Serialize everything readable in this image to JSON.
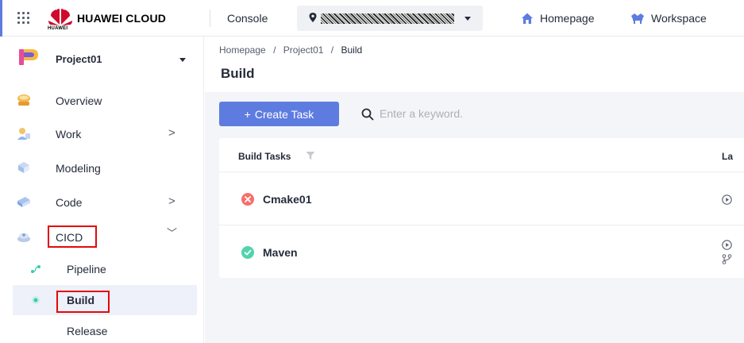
{
  "topbar": {
    "brand": "HUAWEI CLOUD",
    "logo_text": "HUAWEI",
    "console": "Console",
    "homepage": "Homepage",
    "workspace": "Workspace"
  },
  "sidebar": {
    "project": "Project01",
    "items": [
      {
        "label": "Overview"
      },
      {
        "label": "Work",
        "chevron": ">"
      },
      {
        "label": "Modeling"
      },
      {
        "label": "Code",
        "chevron": ">"
      },
      {
        "label": "CICD",
        "chevron": "﹀"
      }
    ],
    "subitems": [
      {
        "label": "Pipeline"
      },
      {
        "label": "Build"
      },
      {
        "label": "Release"
      }
    ]
  },
  "main": {
    "breadcrumb": {
      "home": "Homepage",
      "project": "Project01",
      "current": "Build",
      "sep": "/"
    },
    "title": "Build",
    "create_label": "Create Task",
    "create_plus": "+",
    "search_placeholder": "Enter a keyword.",
    "table": {
      "col_build": "Build Tasks",
      "col_last": "La",
      "rows": [
        {
          "name": "Cmake01",
          "status": "failed"
        },
        {
          "name": "Maven",
          "status": "success"
        }
      ]
    }
  },
  "colors": {
    "accent": "#5e7ce0",
    "failed": "#f66f6a",
    "success": "#50d4ab",
    "highlight_box": "#e20a0a"
  }
}
